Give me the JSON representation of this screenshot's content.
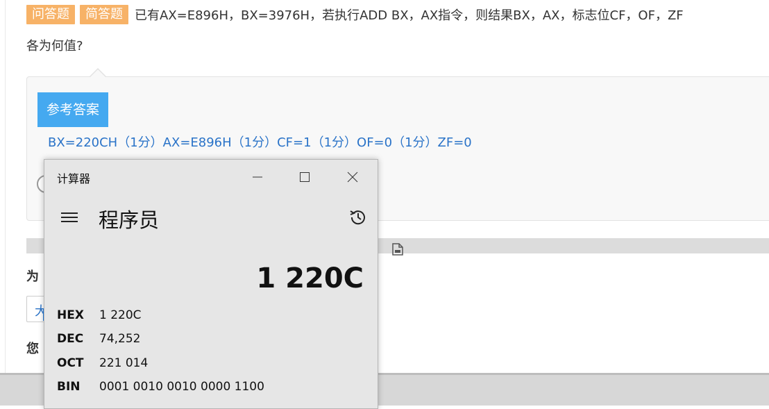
{
  "question": {
    "tag1": "问答题",
    "tag2": "简答题",
    "text_line1": "已有AX=E896H，BX=3976H，若执行ADD BX，AX指令，则结果BX，AX，标志位CF，OF，ZF",
    "text_line2": "各为何值?"
  },
  "answer": {
    "button_label": "参考答案",
    "text": "BX=220CH（1分）AX=E896H（1分）CF=1（1分）OF=0（1分）ZF=0"
  },
  "page": {
    "section_title": "为",
    "input_value": "大",
    "section_title2": "您"
  },
  "calculator": {
    "window_title": "计算器",
    "mode": "程序员",
    "display": "1 220C",
    "bases": [
      {
        "label": "HEX",
        "value": "1 220C"
      },
      {
        "label": "DEC",
        "value": "74,252"
      },
      {
        "label": "OCT",
        "value": "221 014"
      },
      {
        "label": "BIN",
        "value": "0001 0010 0010 0000 1100"
      }
    ]
  },
  "colors": {
    "tag_bg": "#f7b267",
    "ref_button_bg": "#45a9f0",
    "answer_text": "#2a73c8",
    "calc_bg": "#e6e6e6"
  }
}
